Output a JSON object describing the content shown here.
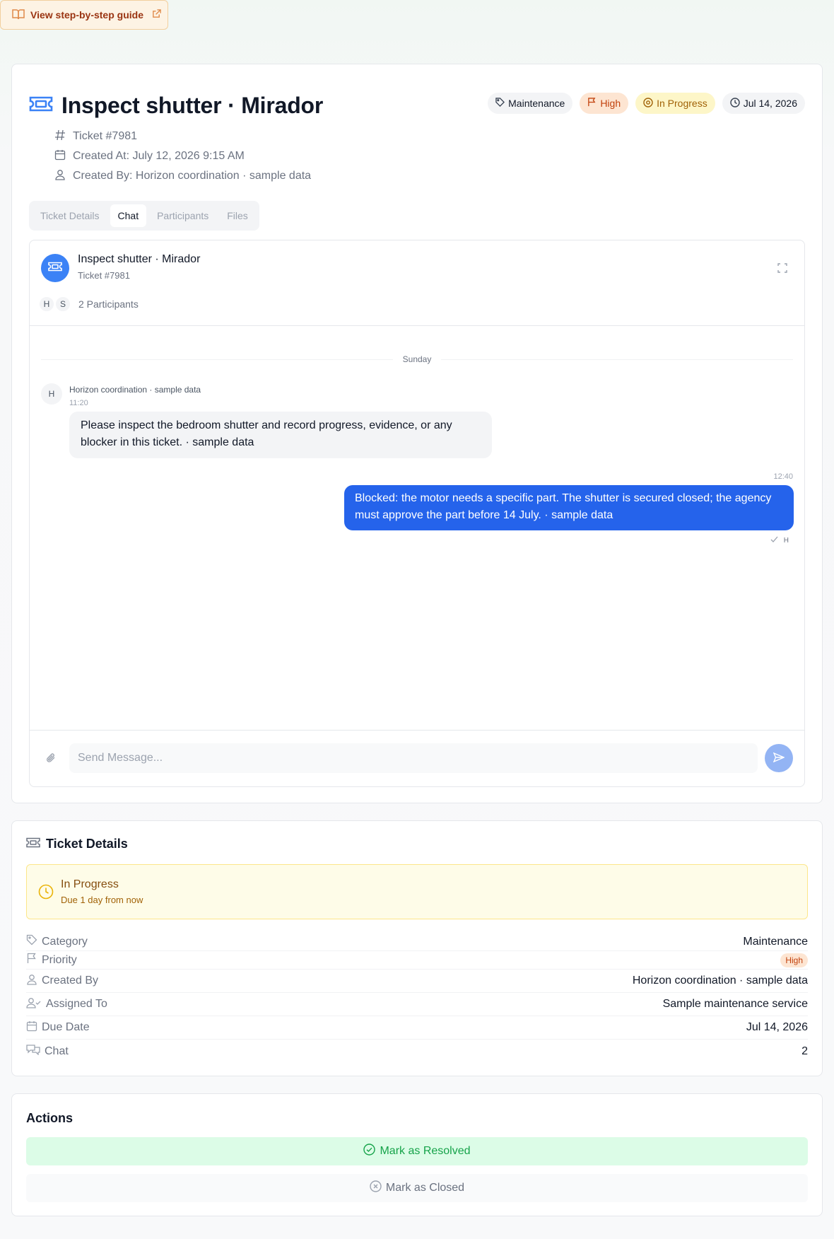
{
  "guide": {
    "label": "View step-by-step guide"
  },
  "ticket": {
    "title": "Inspect shutter · Mirador",
    "number": "Ticket #7981",
    "created_at": "Created At: July 12, 2026 9:15 AM",
    "created_by": "Created By: Horizon coordination · sample data"
  },
  "badges": {
    "category": "Maintenance",
    "priority": "High",
    "status": "In Progress",
    "due": "Jul 14, 2026",
    "colors": {
      "priority_bg": "#fde5d2",
      "priority_fg": "#c2410c",
      "status_bg": "#fdf6c8",
      "status_fg": "#a16207"
    }
  },
  "tabs": [
    {
      "label": "Ticket Details",
      "active": false
    },
    {
      "label": "Chat",
      "active": true
    },
    {
      "label": "Participants",
      "active": false
    },
    {
      "label": "Files",
      "active": false
    }
  ],
  "chat": {
    "title": "Inspect shutter · Mirador",
    "subtitle": "Ticket #7981",
    "participant_initials": [
      "H",
      "S"
    ],
    "participants_label": "2 Participants",
    "day_divider": "Sunday",
    "messages": [
      {
        "direction": "incoming",
        "avatar": "H",
        "sender": "Horizon coordination · sample data",
        "time": "11:20",
        "text": "Please inspect the bedroom shutter and record progress, evidence, or any blocker in this ticket. · sample data"
      },
      {
        "direction": "outgoing",
        "time": "12:40",
        "text": "Blocked: the motor needs a specific part. The shutter is secured closed; the agency must approve the part before 14 July. · sample data",
        "read_by": "H"
      }
    ],
    "input_placeholder": "Send Message...",
    "input_value": "",
    "accent": "#2563eb"
  },
  "details": {
    "title": "Ticket Details",
    "status": "In Progress",
    "due_text": "Due 1 day from now",
    "rows": [
      {
        "icon": "tag-icon",
        "label": "Category",
        "value": "Maintenance"
      },
      {
        "icon": "flag-icon",
        "label": "Priority",
        "value": "High"
      },
      {
        "icon": "user-icon",
        "label": "Created By",
        "value": "Horizon coordination · sample data"
      },
      {
        "icon": "user-check-icon",
        "label": "Assigned To",
        "value": "Sample maintenance service"
      },
      {
        "icon": "calendar-icon",
        "label": "Due Date",
        "value": "Jul 14, 2026"
      },
      {
        "icon": "chat-icon",
        "label": "Chat",
        "value": "2"
      }
    ]
  },
  "actions": {
    "title": "Actions",
    "resolve_label": "Mark as Resolved",
    "close_label": "Mark as Closed"
  }
}
